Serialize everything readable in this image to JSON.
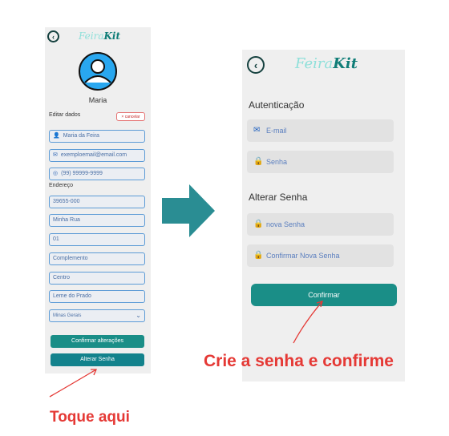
{
  "left_screen": {
    "logo_light": "Feira",
    "logo_bold": "Kit",
    "user_name": "Maria",
    "edit_label": "Editar dados",
    "cancel_label": "× cancelar",
    "fields": [
      {
        "icon": "person-icon",
        "glyph": "👤",
        "value": "Maria da Feira"
      },
      {
        "icon": "mail-icon",
        "glyph": "✉",
        "value": "exemploemail@email.com"
      },
      {
        "icon": "whatsapp-icon",
        "glyph": "◎",
        "value": "(99) 99999-9999"
      }
    ],
    "address_label": "Endereço",
    "address_fields": [
      "39655-000",
      "Minha Rua",
      "01",
      "Complemento",
      "Centro",
      "Leme do Prado"
    ],
    "state_select": "Minas Gerais",
    "confirm_button": "Confirmar alterações",
    "password_button": "Alterar Senha"
  },
  "right_screen": {
    "logo_light": "Feira",
    "logo_bold": "Kit",
    "auth_heading": "Autenticação",
    "email_placeholder": "E-mail",
    "password_placeholder": "Senha",
    "change_heading": "Alterar Senha",
    "new_password_placeholder": "nova Senha",
    "confirm_password_placeholder": "Confirmar Nova Senha",
    "confirm_button": "Confirmar"
  },
  "annotations": {
    "create_confirm": "Crie a senha e confirme",
    "tap_here": "Toque aqui"
  },
  "colors": {
    "primary": "#1a8e87",
    "annotation": "#e53935",
    "arrow": "#2a8d93"
  }
}
